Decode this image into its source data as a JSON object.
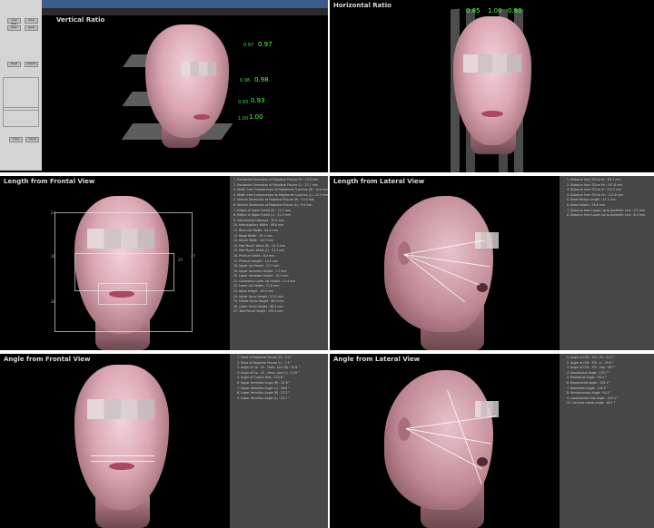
{
  "panels": {
    "vertical": {
      "title": "Vertical Ratio",
      "small_labels": [
        "0.97",
        "0.98",
        "0.93",
        "1.00"
      ],
      "big_values": [
        "0.97",
        "0.98",
        "0.93",
        "1.00"
      ]
    },
    "horizontal": {
      "title": "Horizontal Ratio",
      "ratios": [
        "0.85",
        "1.00",
        "0.80"
      ]
    },
    "length_frontal": {
      "title": "Length from Frontal View",
      "side_labels": [
        "24",
        "26",
        "25",
        "27",
        "28"
      ],
      "items": [
        "1. Horizontal Dimension of Palpebral Fissure (R) : 24.0 mm",
        "2. Horizontal Dimension of Palpebral Fissure (L) : 27.1 mm",
        "3. Width from Endocanthion to Palpebrale Superius (R) : 10.6 mm",
        "4. Width from Endocanthion to Palpebrale Superius (L) : 12.2 mm",
        "5. Vertical Dimension of Palpebral Fissure (R) : 10.9 mm",
        "6. Vertical Dimension of Palpebral Fissure (L) : 9.4 mm",
        "7. Height of Upper Eyelid (R) : 10.7 mm",
        "8. Height of Upper Eyelid (L) : 11.0 mm",
        "9. Intercanthal Distance : 30.5 mm",
        "10. Interpupillary Width : 58.6 mm",
        "11. Binocular Width : 81.9 mm",
        "12. Nasal Width : 35.1 mm",
        "13. Mouth Width : 46.7 mm",
        "14. Half Mouth Width (R) : 24.5 mm",
        "15. Half Mouth Width (L) : 21.2 mm",
        "16. Philtrum Width : 8.0 mm",
        "17. Philtrum Length : 14.5 mm",
        "18. Upper Lip Height : 21.7 mm",
        "19. Upper Vermilion Height : 7.2 mm",
        "20. Lower Vermilion Height : 10.1 mm",
        "21. Cutaneous Lower Lip Height : 11.4 mm",
        "22. Lower Lip Height : 21.8 mm",
        "23. Nasal Height : 53.0 mm",
        "24. Upper Facial Height : 57.0 mm",
        "25. Middle Facial Height : 46.0 mm",
        "26. Lower Facial Height : 68.5 mm",
        "27. Total Facial Height : 135.4 mm"
      ]
    },
    "length_lateral": {
      "title": "Length from Lateral View",
      "items": [
        "1. Distance from TDI to Sn : 85.7 mm",
        "2. Distance from TDI to Pn : 107.8 mm",
        "3. Distance from TDI to Sl : 122.2 mm",
        "4. Distance from TDI to Gn : 123.8 mm",
        "5. Nasal Bridge Length : 41.7 mm",
        "6. Nasal Height : 35.6 mm",
        "7. Distance from Upper Lip to Aesthetic Line : 0.5 mm",
        "8. Distance from Lower Lip to Aesthetic Line : 6.0 mm"
      ]
    },
    "angle_frontal": {
      "title": "Angle from Frontal View",
      "items": [
        "1. Slant of Palpebral Fissure (R) : 5.9 °",
        "2. Slant of Palpebral Fissure (L) : 7.4 °",
        "3. Angle of Lip - Ch - Horiz. Line (R) : 14.8 °",
        "4. Angle of Lip - Ch - Horiz. Line (L) : 13.6 °",
        "5. Angle of Cupid's Bow : 112.8 °",
        "6. Upper Vermilion Angle (R) : 25.8 °",
        "7. Upper Vermilion Angle (L) : 26.8 °",
        "8. Lower Vermilion Angle (R) : 27.2 °",
        "9. Lower Vermilion Angle (L) : 24.7 °"
      ]
    },
    "angle_lateral": {
      "title": "Angle from Lateral View",
      "items": [
        "1. Angle of LTM - TDI - Pn : 31.5 °",
        "2. Angle of LTM - TDI - Li : 29.8 °",
        "3. Angle of LTM - TDI - Pog : 49.7 °",
        "4. Nasofrontal Angle : 133.7 °",
        "5. Nasofacial Angle : 35.0 °",
        "6. Nasomental Angle : 132.5 °",
        "7. Nasolabial Angle : 105.5 °",
        "8. Mentocervical Angle : 90.0 °",
        "9. Labiomental Fold Angle : 129.4 °",
        "10. Cervical Lobule Angle : 80.1 °"
      ]
    }
  },
  "sidebar": {
    "buttons": [
      "Load Mesh",
      "Save",
      "Open",
      "Apply",
      "Reset",
      "Export",
      "Close",
      "Cancel"
    ]
  },
  "colors": {
    "panel_bg": "#000000",
    "list_bg": "#474747",
    "ratio_green": "#39e03a",
    "skin": "#dba6b2"
  }
}
